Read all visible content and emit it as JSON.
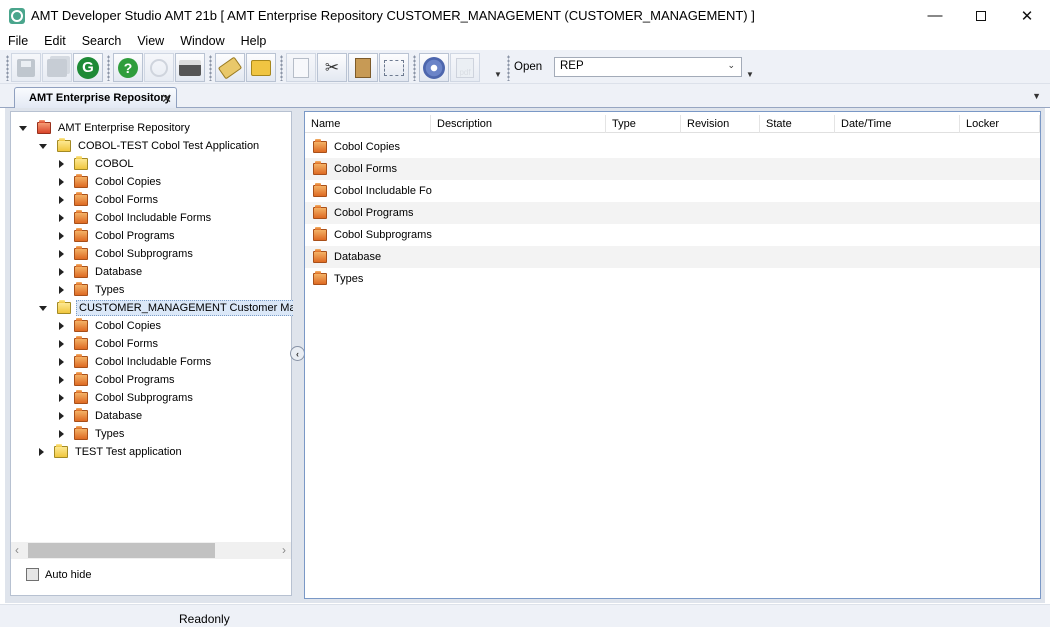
{
  "window": {
    "title": "AMT Developer Studio AMT 21b  [ AMT Enterprise Repository CUSTOMER_MANAGEMENT (CUSTOMER_MANAGEMENT) ]",
    "minimize": "—",
    "close": "✕"
  },
  "menu": [
    "File",
    "Edit",
    "Search",
    "View",
    "Window",
    "Help"
  ],
  "toolbar": {
    "open_label": "Open",
    "open_value": "REP",
    "buttons": [
      "save",
      "save-all",
      "refresh",
      "help",
      "find",
      "print",
      "tag",
      "folder-settings",
      "new-page",
      "cut",
      "paste",
      "select",
      "settings",
      "pdf"
    ]
  },
  "tabs": {
    "active": "AMT Enterprise Repository",
    "close": "✕"
  },
  "tree": {
    "root": "AMT Enterprise Repository",
    "nodes": [
      {
        "label": "COBOL-TEST Cobol Test Application",
        "level": 1,
        "expanded": true,
        "color": "yellow"
      },
      {
        "label": "COBOL",
        "level": 2,
        "expanded": false,
        "color": "yellow"
      },
      {
        "label": "Cobol Copies",
        "level": 2,
        "expanded": false,
        "color": "orange"
      },
      {
        "label": "Cobol Forms",
        "level": 2,
        "expanded": false,
        "color": "orange"
      },
      {
        "label": "Cobol Includable Forms",
        "level": 2,
        "expanded": false,
        "color": "orange"
      },
      {
        "label": "Cobol Programs",
        "level": 2,
        "expanded": false,
        "color": "orange"
      },
      {
        "label": "Cobol Subprograms",
        "level": 2,
        "expanded": false,
        "color": "orange"
      },
      {
        "label": "Database",
        "level": 2,
        "expanded": false,
        "color": "orange"
      },
      {
        "label": "Types",
        "level": 2,
        "expanded": false,
        "color": "orange"
      },
      {
        "label": "CUSTOMER_MANAGEMENT Customer Manag",
        "level": 1,
        "expanded": true,
        "color": "yellow",
        "selected": true
      },
      {
        "label": "Cobol Copies",
        "level": 2,
        "expanded": false,
        "color": "orange"
      },
      {
        "label": "Cobol Forms",
        "level": 2,
        "expanded": false,
        "color": "orange"
      },
      {
        "label": "Cobol Includable Forms",
        "level": 2,
        "expanded": false,
        "color": "orange"
      },
      {
        "label": "Cobol Programs",
        "level": 2,
        "expanded": false,
        "color": "orange"
      },
      {
        "label": "Cobol Subprograms",
        "level": 2,
        "expanded": false,
        "color": "orange"
      },
      {
        "label": "Database",
        "level": 2,
        "expanded": false,
        "color": "orange"
      },
      {
        "label": "Types",
        "level": 2,
        "expanded": false,
        "color": "orange"
      },
      {
        "label": "TEST Test application",
        "level": 1,
        "expanded": false,
        "color": "yellow"
      }
    ]
  },
  "left_pane": {
    "autohide_label": "Auto hide",
    "scroll_left": "‹",
    "scroll_right": "›",
    "collapse": "‹"
  },
  "list": {
    "columns": [
      "Name",
      "Description",
      "Type",
      "Revision",
      "State",
      "Date/Time",
      "Locker"
    ],
    "rows": [
      "Cobol Copies",
      "Cobol Forms",
      "Cobol Includable Form",
      "Cobol Programs",
      "Cobol Subprograms",
      "Database",
      "Types"
    ]
  },
  "status": {
    "text": "Readonly"
  },
  "colors": {
    "accent": "#7a98c6",
    "folder_orange": "#de6a23",
    "folder_yellow": "#f0c63e"
  }
}
